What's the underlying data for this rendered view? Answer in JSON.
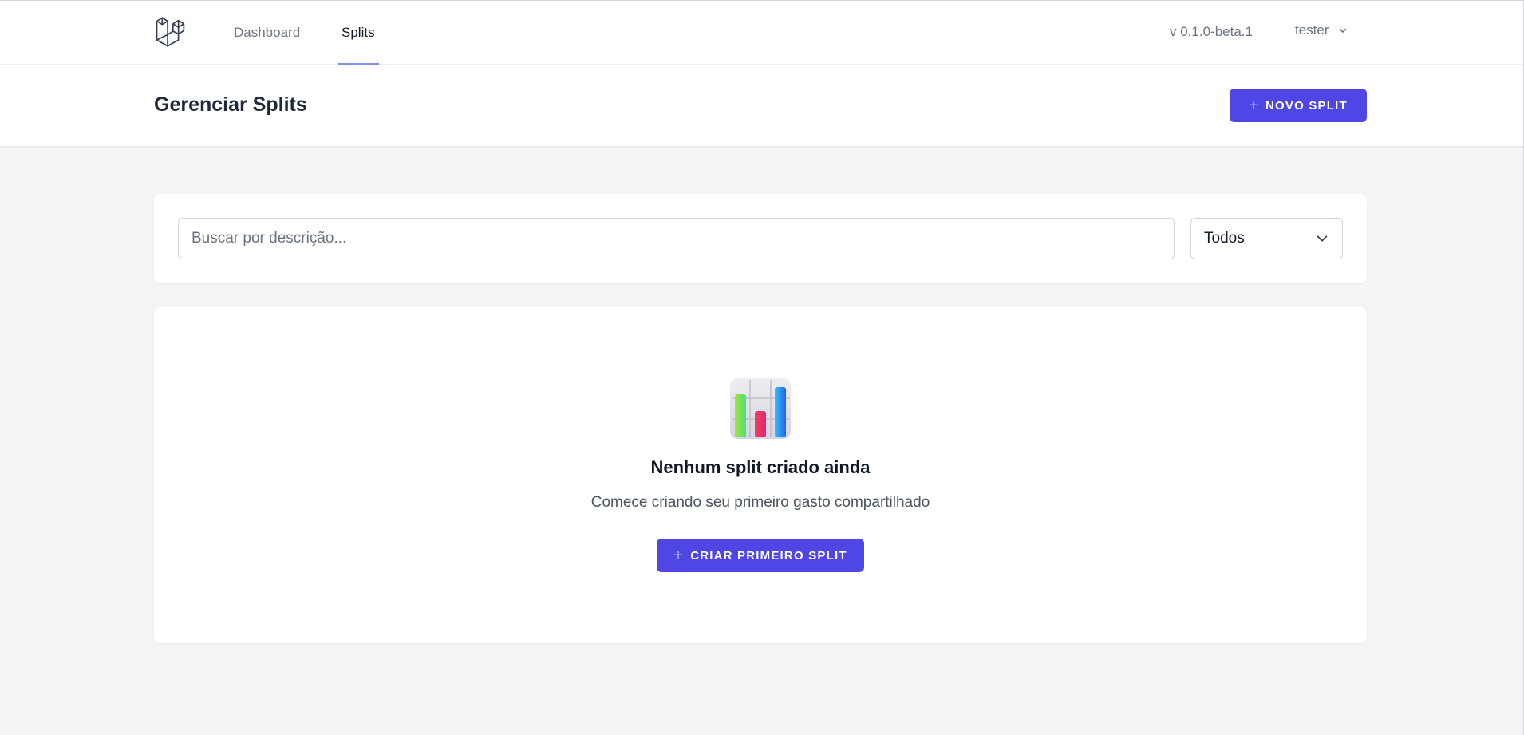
{
  "nav": {
    "links": [
      {
        "label": "Dashboard"
      },
      {
        "label": "Splits"
      }
    ],
    "version": "v 0.1.0-beta.1",
    "user_name": "tester"
  },
  "header": {
    "title": "Gerenciar Splits",
    "new_button_label": "NOVO SPLIT"
  },
  "filters": {
    "search_placeholder": "Buscar por descrição...",
    "search_value": "",
    "status_selected": "Todos"
  },
  "empty_state": {
    "title": "Nenhum split criado ainda",
    "subtitle": "Comece criando seu primeiro gasto compartilhado",
    "cta_label": "CRIAR PRIMEIRO SPLIT"
  },
  "theme": {
    "primary": "#4f46e5",
    "active_underline": "#818cf8",
    "background": "#f3f4f6"
  },
  "icons": {
    "logo": "laravel-logo-icon",
    "user_dropdown": "chevron-down-icon",
    "select_dropdown": "chevron-down-icon",
    "plus": "plus-icon",
    "empty_state": "bar-chart-icon"
  }
}
